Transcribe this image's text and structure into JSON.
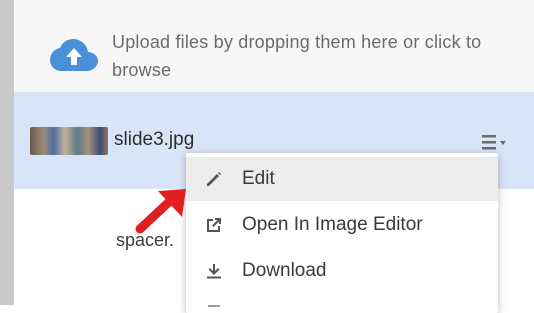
{
  "upload": {
    "text": "Upload files by dropping them here or click to browse",
    "icon": "cloud-upload-icon",
    "icon_color": "#4a90d9"
  },
  "files": [
    {
      "name": "slide3.jpg",
      "thumbnail": "image-thumbnail"
    },
    {
      "name": "spacer."
    }
  ],
  "menu": {
    "trigger_icon": "list-dropdown-icon",
    "items": [
      {
        "label": "Edit",
        "icon": "pencil-icon"
      },
      {
        "label": "Open In Image Editor",
        "icon": "open-external-icon"
      },
      {
        "label": "Download",
        "icon": "download-icon"
      }
    ]
  },
  "annotation": {
    "icon": "red-arrow-icon",
    "color": "#e02020"
  },
  "colors": {
    "selected_row": "#d7e5f7",
    "menu_hover": "#ececec"
  }
}
